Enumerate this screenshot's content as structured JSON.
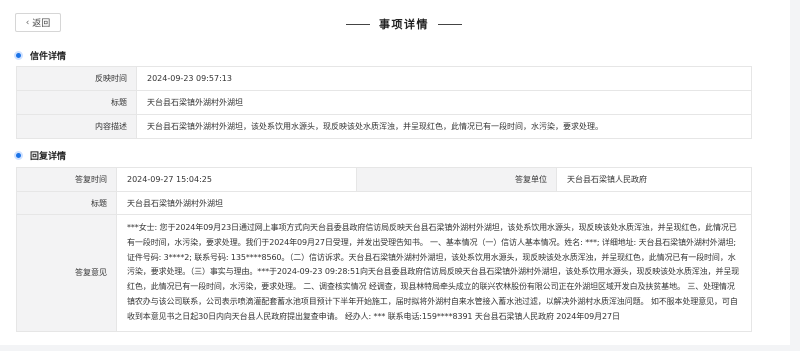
{
  "header": {
    "back_label": "返回",
    "title": "事项详情"
  },
  "letter": {
    "section_title": "信件详情",
    "rows": [
      {
        "label": "反映时间",
        "value": "2024-09-23 09:57:13"
      },
      {
        "label": "标题",
        "value": "天台县石梁镇外湖村外湖坦"
      },
      {
        "label": "内容描述",
        "value": "天台县石梁镇外湖村外湖坦，该处系饮用水源头，现反映该处水质浑浊，并呈现红色，此情况已有一段时间，水污染，要求处理。"
      }
    ]
  },
  "reply": {
    "section_title": "回复详情",
    "time_label": "答复时间",
    "time_value": "2024-09-27 15:04:25",
    "unit_label": "答复单位",
    "unit_value": "天台县石梁镇人民政府",
    "title_label": "标题",
    "title_value": "天台县石梁镇外湖村外湖坦",
    "opinion_label": "答复意见",
    "opinion_value": "***女士: 您于2024年09月23日通过网上事项方式向天台县委县政府信访局反映天台县石梁镇外湖村外湖坦，该处系饮用水源头，现反映该处水质浑浊，并呈现红色，此情况已有一段时间，水污染，要求处理。我们于2024年09月27日受理，并发出受理告知书。 一、基本情况（一）信访人基本情况。姓名: ***; 详细地址: 天台县石梁镇外湖村外湖坦; 证件号码: 3****2; 联系号码: 135****8560。（二）信访诉求。天台县石梁镇外湖村外湖坦，该处系饮用水源头，现反映该处水质浑浊，并呈现红色，此情况已有一段时间，水污染，要求处理。（三）事实与理由。***于2024-09-23 09:28:51向天台县委县政府信访局反映天台县石梁镇外湖村外湖坦，该处系饮用水源头，现反映该处水质浑浊，并呈现红色，此情况已有一段时间，水污染，要求处理。 二、调查核实情况 经调查，现县林特局牵头成立的联兴农林股份有限公司正在外湖坦区域开发白及扶贫基地。 三、处理情况 镇农办与该公司联系，公司表示喷滴灌配套蓄水池项目预计下半年开始施工，届时拟将外湖村自来水管接入蓄水池过滤，以解决外湖村水质浑浊问题。 如不服本处理意见，可自收到本意见书之日起30日内向天台县人民政府提出复查申请。 经办人: *** 联系电话:159****8391 天台县石梁镇人民政府 2024年09月27日"
  }
}
